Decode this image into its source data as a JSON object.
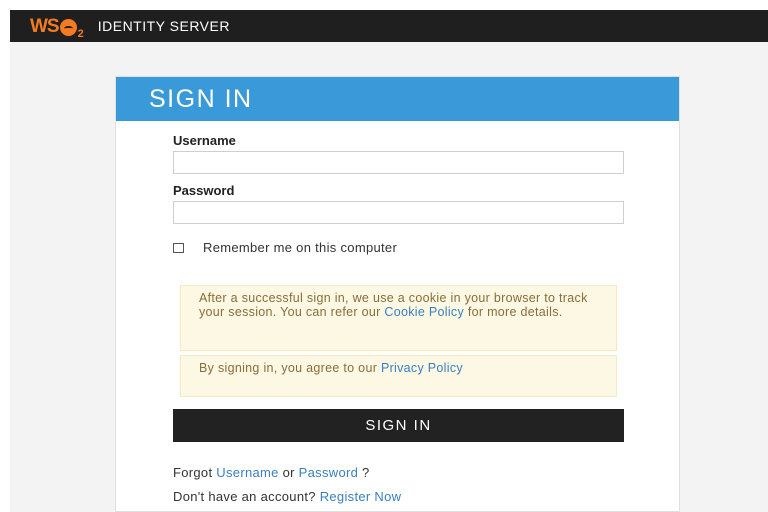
{
  "brand": {
    "logo_ws": "WS",
    "logo_2": "2",
    "product_name": "IDENTITY SERVER",
    "accent": "#f47b20"
  },
  "card": {
    "title": "SIGN IN",
    "header_color": "#3a9ad9"
  },
  "form": {
    "username_label": "Username",
    "username_value": "",
    "password_label": "Password",
    "password_value": "",
    "remember_label": "Remember me on this computer",
    "remember_checked": false
  },
  "cookie_notice": {
    "text_before": "After a successful sign in, we use a cookie in your browser to track your session. You can refer our ",
    "link": "Cookie Policy",
    "text_after": " for more details."
  },
  "privacy_notice": {
    "text_before": "By signing in, you agree to our ",
    "link": "Privacy Policy"
  },
  "signin_button": "SIGN IN",
  "forgot": {
    "prefix": "Forgot ",
    "username_link": "Username",
    "middle": " or ",
    "password_link": "Password",
    "suffix": " ?"
  },
  "register": {
    "prefix": "Don't have an account? ",
    "link": "Register Now"
  }
}
